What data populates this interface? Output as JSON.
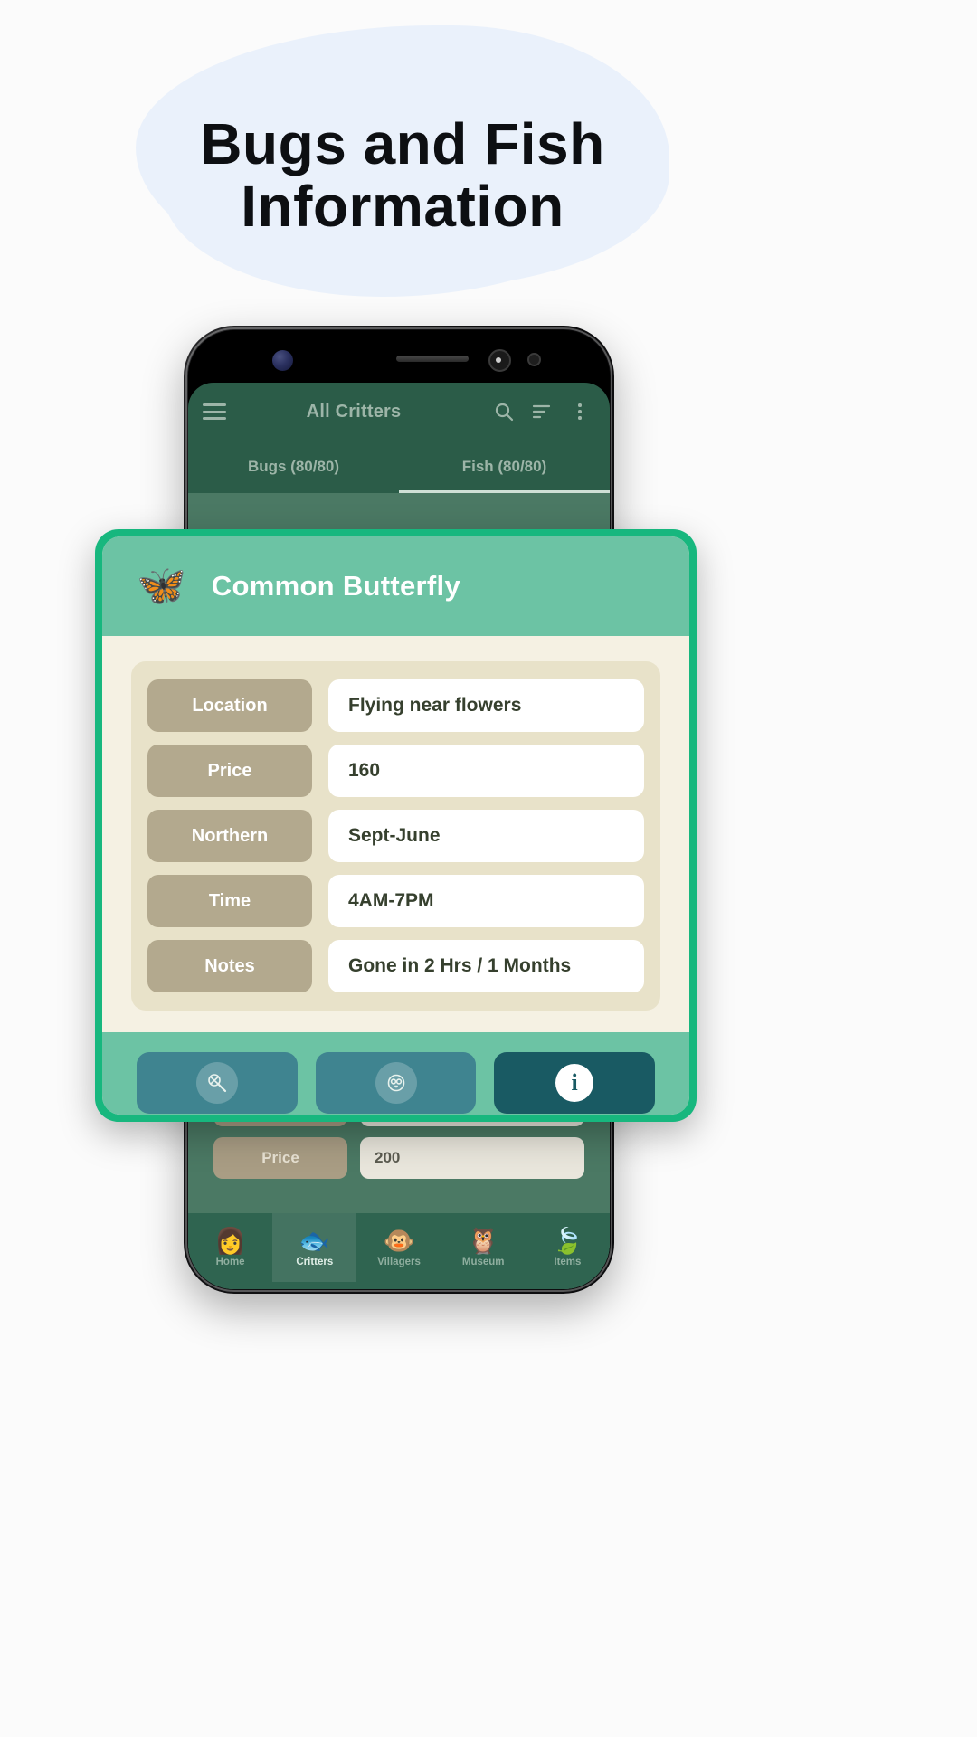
{
  "headline": {
    "line1": "Bugs and Fish",
    "line2": "Information"
  },
  "phone": {
    "toolbar": {
      "menu_icon": "hamburger-menu-icon",
      "title": "All Critters",
      "search_icon": "search-icon",
      "sort_icon": "sort-icon",
      "overflow_icon": "more-vertical-icon"
    },
    "tabs": [
      {
        "label": "Bugs (80/80)",
        "active": false
      },
      {
        "label": "Fish (80/80)",
        "active": true
      }
    ],
    "background_rows": [
      {
        "label": "Price",
        "value": "200"
      }
    ],
    "bottom_nav": [
      {
        "label": "Home",
        "icon": "👩",
        "active": false
      },
      {
        "label": "Critters",
        "icon": "🐟",
        "active": true
      },
      {
        "label": "Villagers",
        "icon": "🐵",
        "active": false
      },
      {
        "label": "Museum",
        "icon": "🦉",
        "active": false
      },
      {
        "label": "Items",
        "icon": "🍃",
        "active": false
      }
    ]
  },
  "modal": {
    "icon": "🦋",
    "title": "Common Butterfly",
    "rows": [
      {
        "label": "Location",
        "value": "Flying near flowers"
      },
      {
        "label": "Price",
        "value": "160"
      },
      {
        "label": "Northern",
        "value": "Sept-June"
      },
      {
        "label": "Time",
        "value": "4AM-7PM"
      },
      {
        "label": "Notes",
        "value": "Gone in 2 Hrs / 1 Months"
      }
    ],
    "footer_buttons": [
      {
        "icon": "net-icon",
        "glyph": "🥅",
        "active": false
      },
      {
        "icon": "owl-icon",
        "glyph": "🦉",
        "active": false
      },
      {
        "icon": "info-icon",
        "glyph": "i",
        "active": true
      }
    ]
  },
  "colors": {
    "modal_border": "#17b77e",
    "modal_header": "#6cc3a4",
    "label_chip": "#b3a98e",
    "app_bar": "#2b5c48",
    "blob": "#eaf1fb",
    "active_button": "#195a63"
  }
}
